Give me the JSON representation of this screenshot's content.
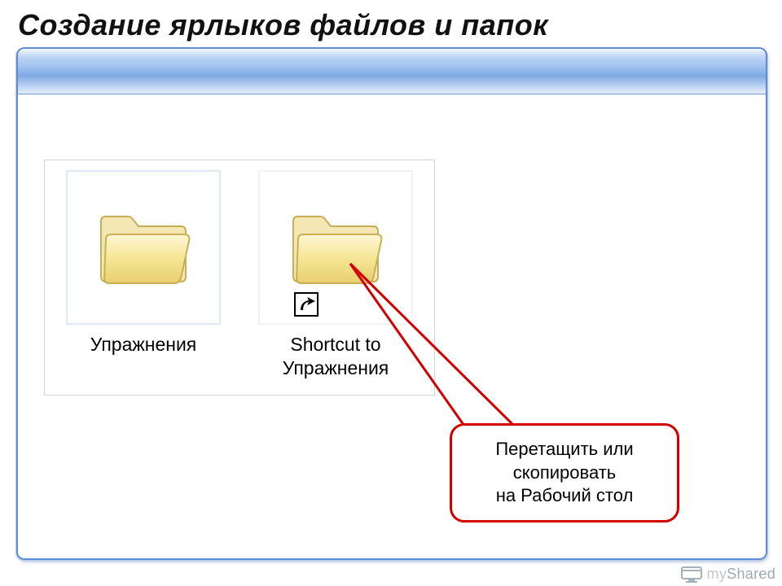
{
  "title": "Создание ярлыков файлов и папок",
  "items": {
    "folder_label": "Упражнения",
    "shortcut_label": "Shortcut to\nУпражнения"
  },
  "callout_text": "Перетащить или\nскопировать\nна Рабочий стол",
  "watermark": {
    "my": "my",
    "shared": "Shared"
  }
}
